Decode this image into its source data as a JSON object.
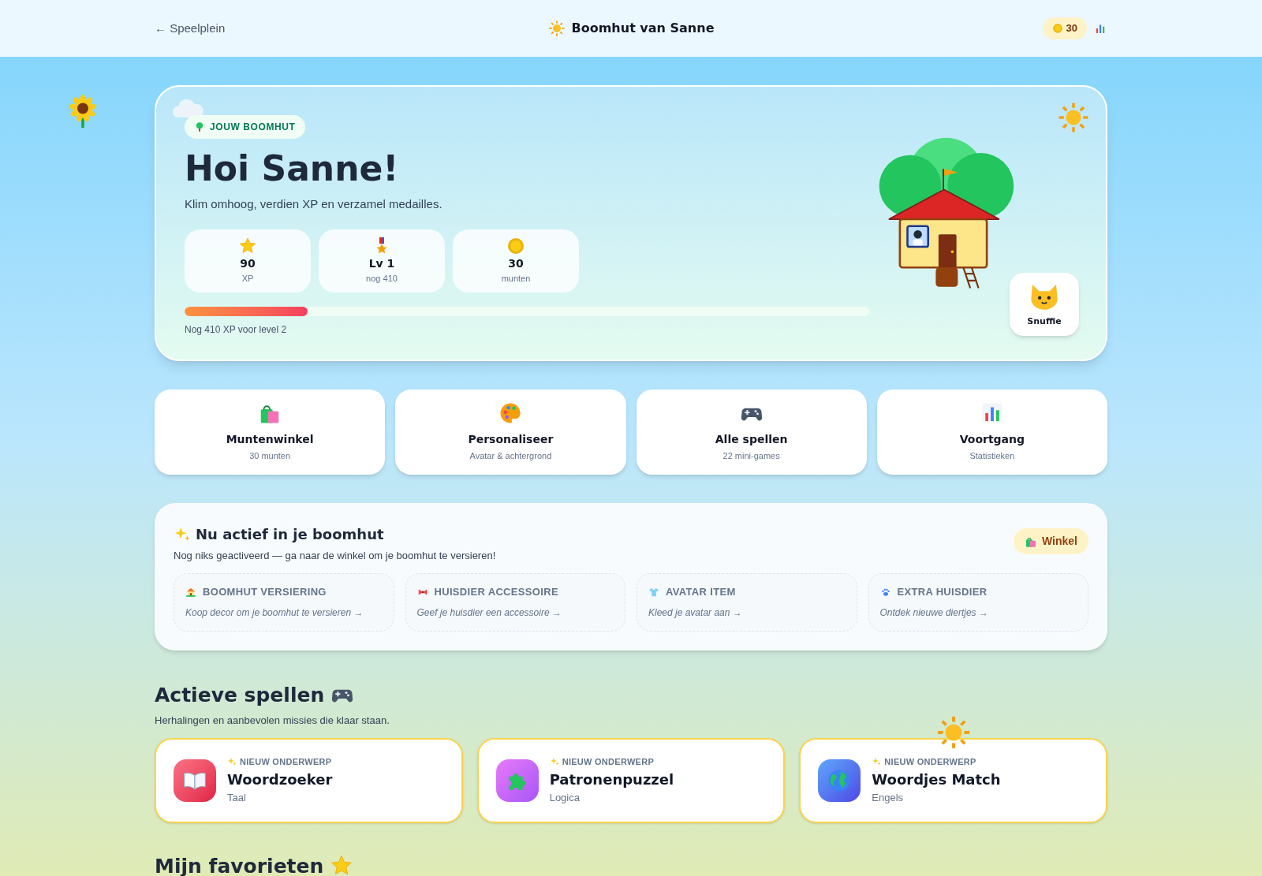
{
  "header": {
    "back_link": "← Speelplein",
    "title": "Boomhut van Sanne",
    "coins": "30"
  },
  "hero": {
    "badge": "JOUW BOOMHUT",
    "title": "Hoi Sanne!",
    "subtitle": "Klim omhoog, verdien XP en verzamel medailles.",
    "stats": [
      {
        "value": "90",
        "label": "XP"
      },
      {
        "value": "Lv 1",
        "label": "nog 410"
      },
      {
        "value": "30",
        "label": "munten"
      }
    ],
    "progress": {
      "level": 0.18,
      "caption": "Nog 410 XP voor level 2"
    },
    "pet_name": "Snuffie"
  },
  "shortcuts": [
    {
      "title": "Muntenwinkel",
      "subtitle": "30 munten"
    },
    {
      "title": "Personaliseer",
      "subtitle": "Avatar & achtergrond"
    },
    {
      "title": "Alle spellen",
      "subtitle": "22 mini-games"
    },
    {
      "title": "Voortgang",
      "subtitle": "Statistieken"
    }
  ],
  "active": {
    "title": "Nu actief in je boomhut",
    "subtitle": "Nog niks geactiveerd — ga naar de winkel om je boomhut te versieren!",
    "button": "Winkel",
    "slots": [
      {
        "title": "BOOMHUT VERSIERING",
        "hint": "Koop decor om je boomhut te versieren →"
      },
      {
        "title": "HUISDIER ACCESSOIRE",
        "hint": "Geef je huisdier een accessoire →"
      },
      {
        "title": "AVATAR ITEM",
        "hint": "Kleed je avatar aan →"
      },
      {
        "title": "EXTRA HUISDIER",
        "hint": "Ontdek nieuwe diertjes →"
      }
    ]
  },
  "games": {
    "title": "Actieve spellen",
    "subtitle": "Herhalingen en aanbevolen missies die klaar staan.",
    "items": [
      {
        "tag": "NIEUW ONDERWERP",
        "title": "Woordzoeker",
        "subject": "Taal"
      },
      {
        "tag": "NIEUW ONDERWERP",
        "title": "Patronenpuzzel",
        "subject": "Logica"
      },
      {
        "tag": "NIEUW ONDERWERP",
        "title": "Woordjes Match",
        "subject": "Engels"
      }
    ]
  },
  "favorites": {
    "title": "Mijn favorieten"
  }
}
